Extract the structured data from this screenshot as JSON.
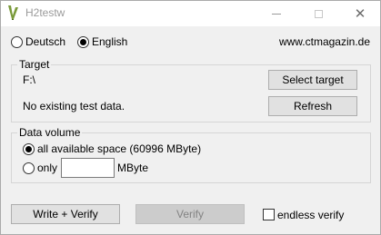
{
  "window": {
    "title": "H2testw",
    "controls": {
      "minimize": "minimize-icon",
      "maximize": "maximize-icon",
      "close": "close-icon"
    },
    "app_icon": "h2testw-app-icon"
  },
  "language": {
    "options": [
      {
        "label": "Deutsch",
        "selected": false
      },
      {
        "label": "English",
        "selected": true
      }
    ],
    "website": "www.ctmagazin.de"
  },
  "target": {
    "title": "Target",
    "path": "F:\\",
    "status": "No existing test data.",
    "select_button": "Select target",
    "refresh_button": "Refresh"
  },
  "volume": {
    "title": "Data volume",
    "all_space_label": "all available space (60996 MByte)",
    "all_space_selected": true,
    "only_label": "only",
    "only_value": "",
    "unit": "MByte"
  },
  "actions": {
    "write_verify": "Write + Verify",
    "verify": "Verify",
    "verify_enabled": false,
    "endless_verify": "endless verify",
    "endless_checked": false
  }
}
